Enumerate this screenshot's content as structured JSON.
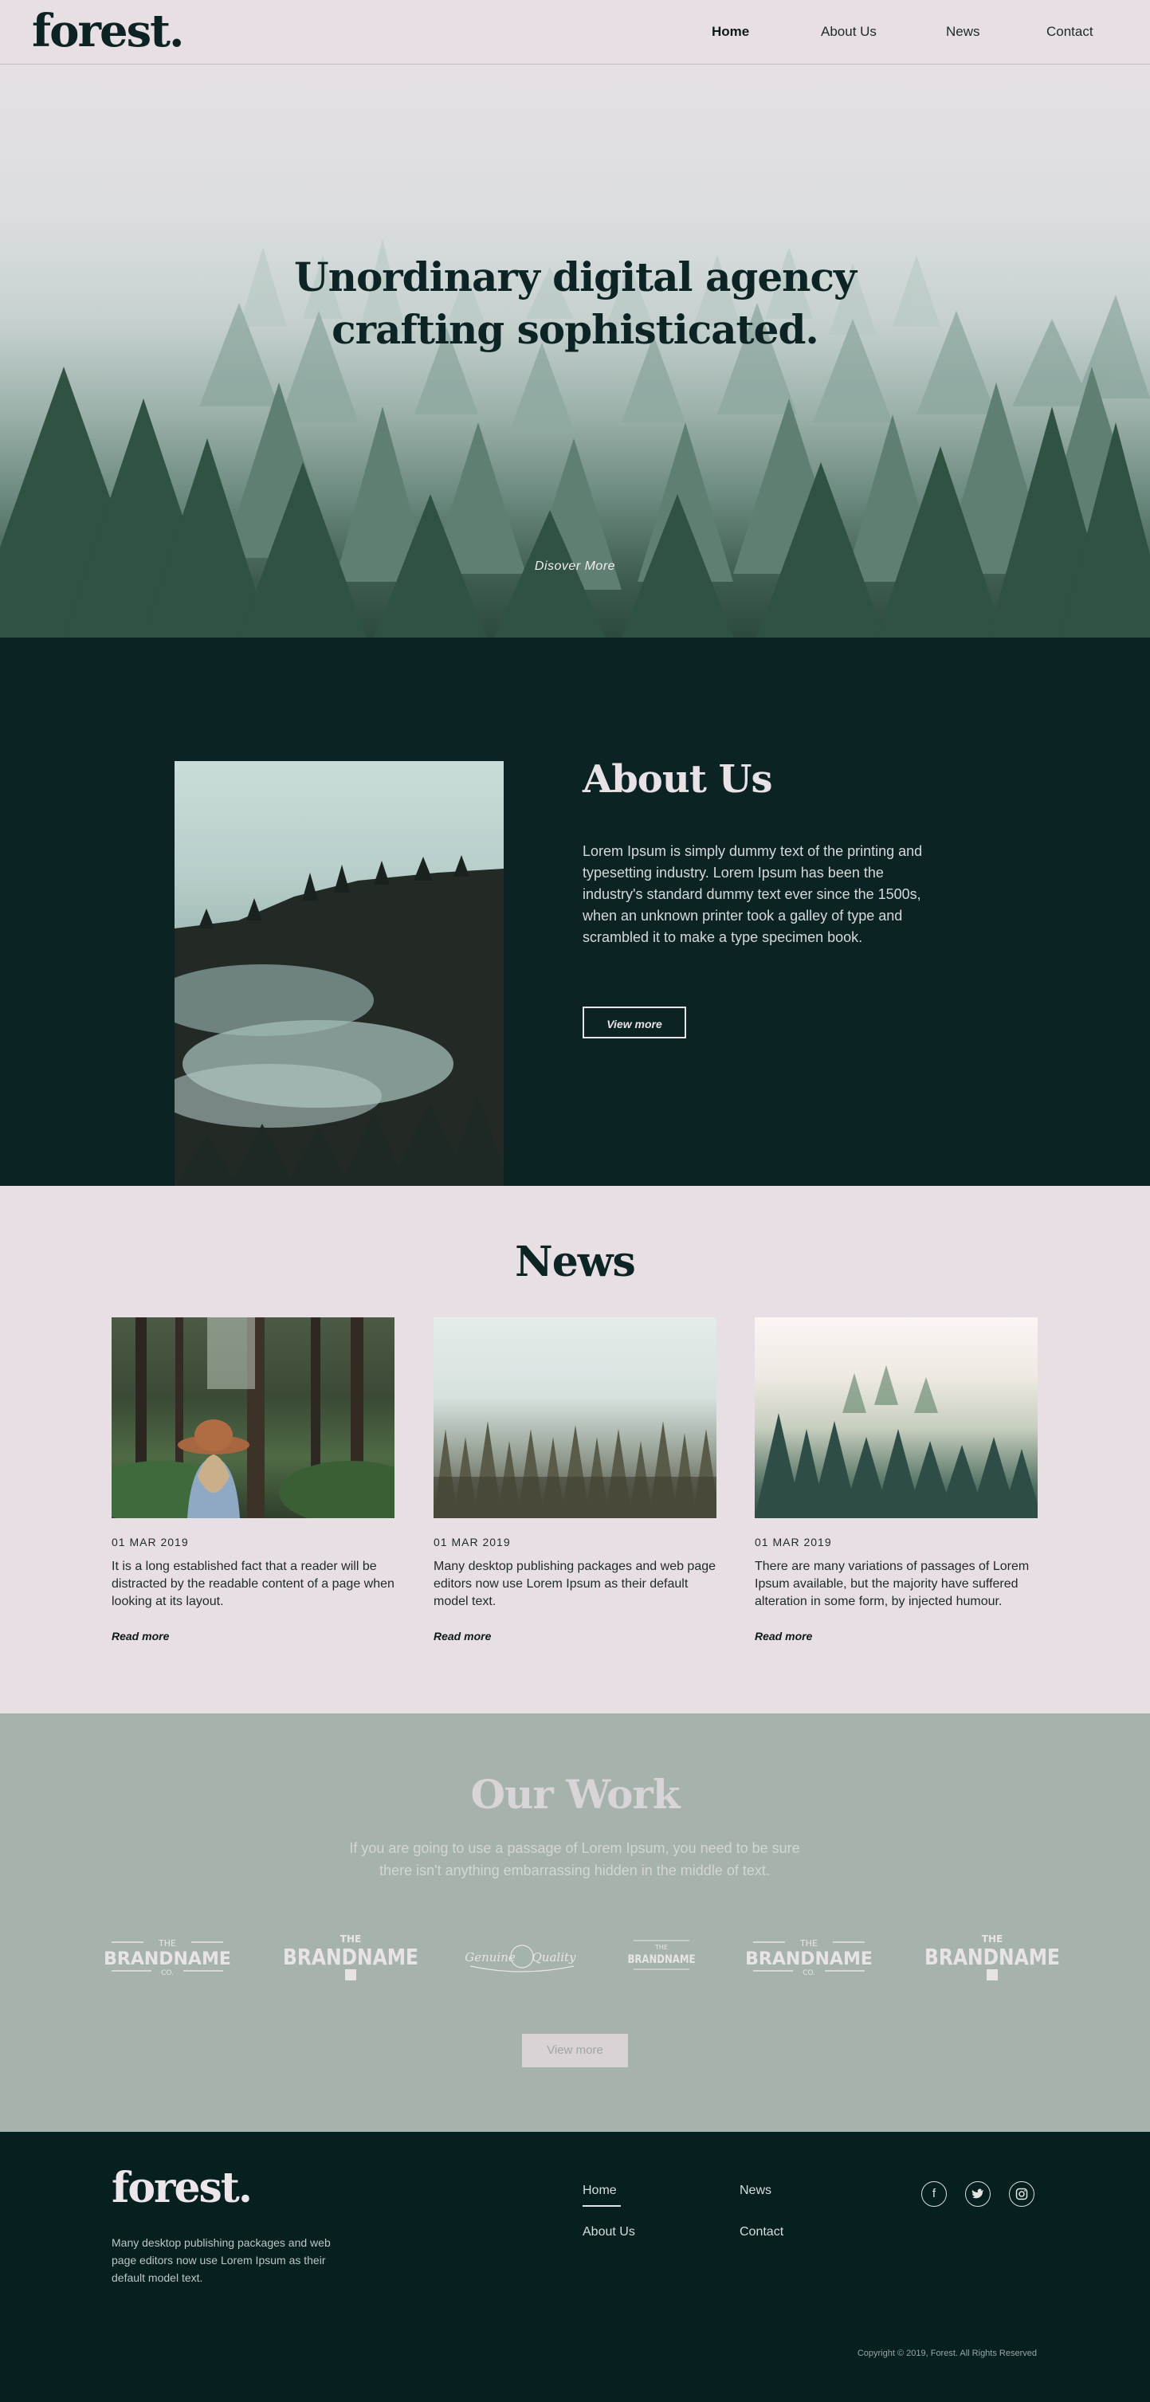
{
  "nav": {
    "logo": "forest.",
    "links": [
      "Home",
      "About Us",
      "News",
      "Contact"
    ]
  },
  "hero": {
    "title_line1": "Unordinary digital agency",
    "title_line2": "crafting sophisticated.",
    "cta": "Disover More"
  },
  "about": {
    "title": "About Us",
    "text": "Lorem Ipsum is simply dummy text of the printing and typesetting industry. Lorem Ipsum has been the industry's standard dummy text ever since the 1500s, when an unknown printer took a galley of type and scrambled it to make a type specimen book.",
    "button": "View more"
  },
  "news": {
    "title": "News",
    "items": [
      {
        "date": "01 MAR 2019",
        "text": "It is a long established fact that a reader will be distracted by the readable content of a page when looking at its layout.",
        "more": "Read more"
      },
      {
        "date": "01 MAR 2019",
        "text": "Many desktop publishing packages and web page editors now use Lorem Ipsum as their default model text.",
        "more": "Read more"
      },
      {
        "date": "01 MAR 2019",
        "text": "There are many variations of passages of Lorem Ipsum available, but the majority have suffered alteration in some form, by injected humour.",
        "more": "Read more"
      }
    ]
  },
  "work": {
    "title": "Our Work",
    "subtitle": "If you are going to use a passage of Lorem Ipsum, you need to be sure there isn't anything embarrassing hidden in the middle of text.",
    "brands": [
      "THE",
      "BRANDNAME",
      "CO.",
      "Genuine",
      "Quality"
    ],
    "button": "View more"
  },
  "footer": {
    "logo": "forest.",
    "description": "Many desktop publishing packages and web page editors now use Lorem Ipsum as their default model text.",
    "links": [
      "Home",
      "News",
      "About Us",
      "Contact"
    ],
    "social": [
      "facebook-icon",
      "twitter-icon",
      "instagram-icon"
    ],
    "copyright": "Copyright © 2019, Forest. All Rights Reserved"
  }
}
